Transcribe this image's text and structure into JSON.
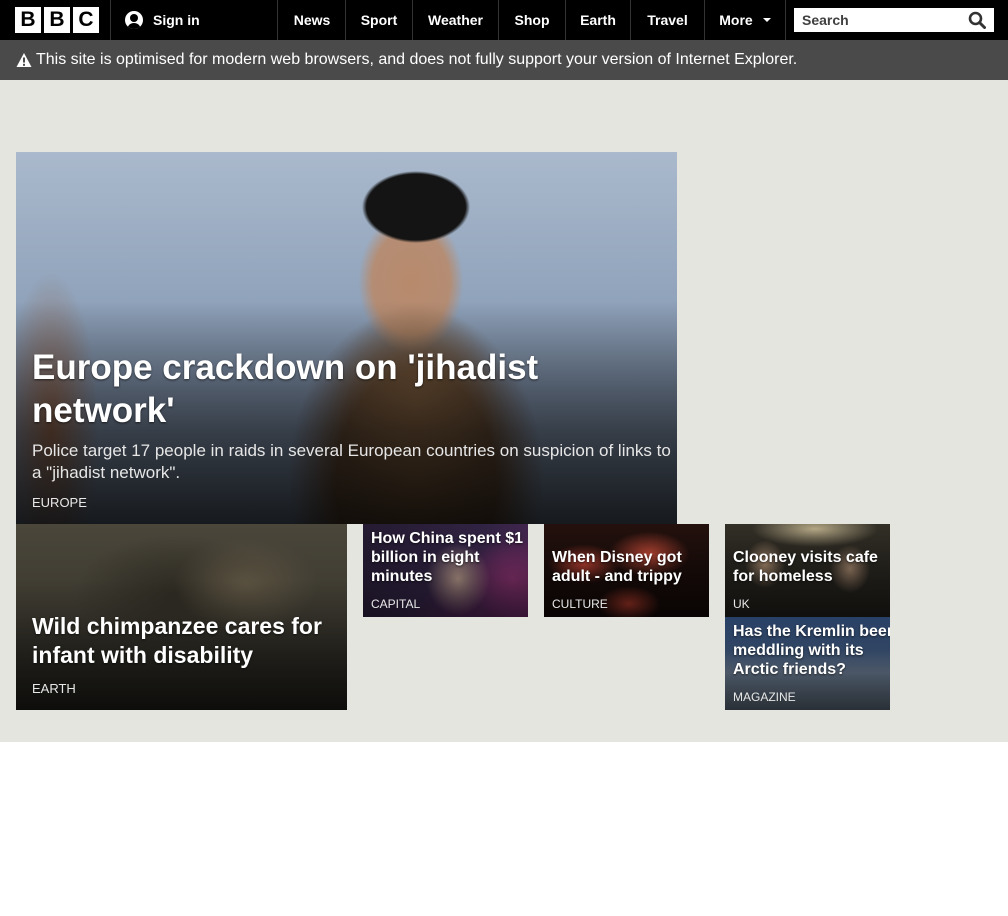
{
  "header": {
    "logo_letters": [
      "B",
      "B",
      "C"
    ],
    "signin_label": "Sign in",
    "nav": [
      "News",
      "Sport",
      "Weather",
      "Shop",
      "Earth",
      "Travel",
      "More"
    ],
    "search_placeholder": "Search"
  },
  "warning": {
    "text": "This site is optimised for modern web browsers, and does not fully support your version of Internet Explorer."
  },
  "hero": {
    "title": "Europe crackdown on 'jihadist network'",
    "summary": "Police target 17 people in raids in several European countries on suspicion of links to a \"jihadist network\".",
    "section": "EUROPE"
  },
  "stories": {
    "chimp": {
      "title": "Wild chimpanzee cares for infant with disability",
      "section": "EARTH"
    },
    "china": {
      "title": "How China spent $1 billion in eight minutes",
      "section": "CAPITAL"
    },
    "disney": {
      "title": "When Disney got adult - and trippy",
      "section": "CULTURE"
    },
    "clooney": {
      "title": "Clooney visits cafe for homeless",
      "section": "UK"
    },
    "kremlin": {
      "title": "Has the Kremlin been meddling with its Arctic friends?",
      "section": "MAGAZINE"
    }
  }
}
